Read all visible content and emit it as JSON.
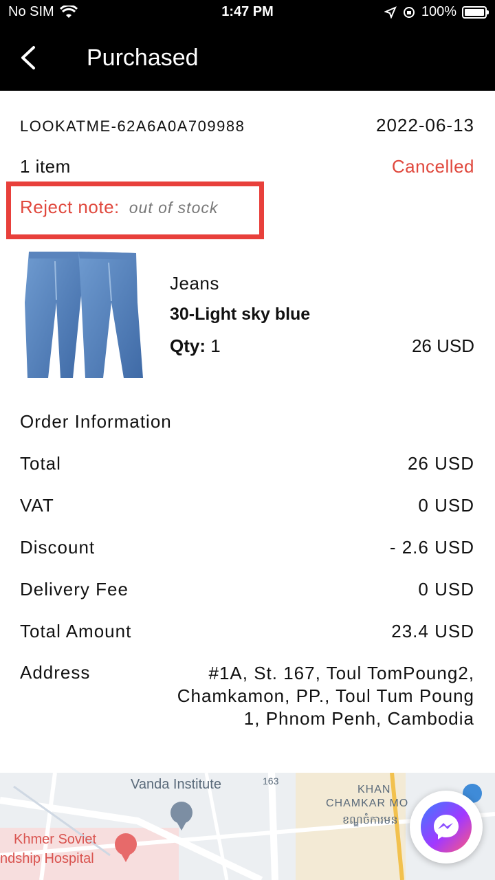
{
  "status_bar": {
    "carrier": "No SIM",
    "time": "1:47 PM",
    "battery": "100%",
    "battery_level": 1.0
  },
  "header": {
    "title": "Purchased"
  },
  "order": {
    "id": "LOOKATME-62A6A0A709988",
    "date": "2022-06-13",
    "item_count": "1 item",
    "status": "Cancelled",
    "reject_label": "Reject note:",
    "reject_text": "out of stock"
  },
  "product": {
    "name": "Jeans",
    "variant": "30-Light sky blue",
    "qty_label": "Qty:",
    "qty_value": "1",
    "price": "26 USD"
  },
  "order_info": {
    "title": "Order Information",
    "rows": [
      {
        "label": "Total",
        "value": "26 USD"
      },
      {
        "label": "VAT",
        "value": "0 USD"
      },
      {
        "label": "Discount",
        "value": "- 2.6 USD"
      },
      {
        "label": "Delivery Fee",
        "value": "0 USD"
      },
      {
        "label": "Total Amount",
        "value": "23.4 USD"
      }
    ],
    "address_label": "Address",
    "address_value": "#1A, St. 167, Toul TomPoung2, Chamkamon, PP., Toul Tum Poung 1, Phnom Penh, Cambodia"
  },
  "map": {
    "labels": [
      "Vanda Institute",
      "KHAN",
      "CHAMKAR MO",
      "ខណ្ឌចំការមន",
      "Khmer Soviet",
      "ndship Hospital",
      "163"
    ]
  },
  "colors": {
    "accent_red": "#e0483d",
    "header_bg": "#000000"
  }
}
